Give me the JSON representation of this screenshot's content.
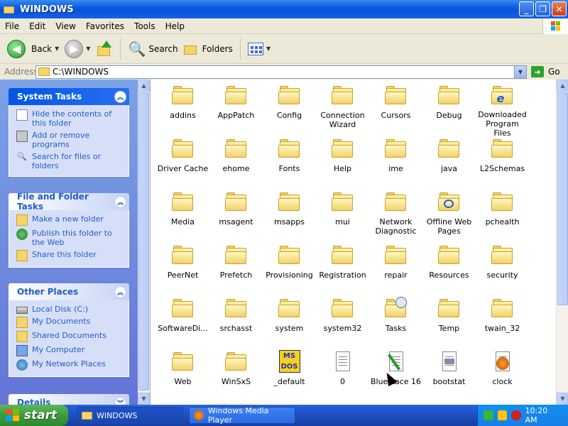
{
  "window": {
    "title": "WINDOWS"
  },
  "menu": [
    "File",
    "Edit",
    "View",
    "Favorites",
    "Tools",
    "Help"
  ],
  "toolbar": {
    "back_label": "Back",
    "search_label": "Search",
    "folders_label": "Folders"
  },
  "address": {
    "label": "Address",
    "value": "C:\\WINDOWS",
    "go_label": "Go"
  },
  "sidebar": {
    "system_tasks": {
      "title": "System Tasks",
      "items": [
        "Hide the contents of this folder",
        "Add or remove programs",
        "Search for files or folders"
      ]
    },
    "file_folder_tasks": {
      "title": "File and Folder Tasks",
      "items": [
        "Make a new folder",
        "Publish this folder to the Web",
        "Share this folder"
      ]
    },
    "other_places": {
      "title": "Other Places",
      "items": [
        "Local Disk (C:)",
        "My Documents",
        "Shared Documents",
        "My Computer",
        "My Network Places"
      ]
    },
    "details": {
      "title": "Details"
    }
  },
  "items": [
    {
      "label": "addins",
      "kind": "folder"
    },
    {
      "label": "AppPatch",
      "kind": "folder"
    },
    {
      "label": "Config",
      "kind": "folder"
    },
    {
      "label": "Connection Wizard",
      "kind": "folder"
    },
    {
      "label": "Cursors",
      "kind": "folder"
    },
    {
      "label": "Debug",
      "kind": "folder"
    },
    {
      "label": "Downloaded Program Files",
      "kind": "ie-folder"
    },
    {
      "label": "Driver Cache",
      "kind": "folder"
    },
    {
      "label": "ehome",
      "kind": "folder"
    },
    {
      "label": "Fonts",
      "kind": "folder"
    },
    {
      "label": "Help",
      "kind": "folder"
    },
    {
      "label": "ime",
      "kind": "folder"
    },
    {
      "label": "java",
      "kind": "folder"
    },
    {
      "label": "L2Schemas",
      "kind": "folder"
    },
    {
      "label": "Media",
      "kind": "folder"
    },
    {
      "label": "msagent",
      "kind": "folder"
    },
    {
      "label": "msapps",
      "kind": "folder"
    },
    {
      "label": "mui",
      "kind": "folder"
    },
    {
      "label": "Network Diagnostic",
      "kind": "folder"
    },
    {
      "label": "Offline Web Pages",
      "kind": "offline-folder"
    },
    {
      "label": "pchealth",
      "kind": "folder"
    },
    {
      "label": "PeerNet",
      "kind": "folder"
    },
    {
      "label": "Prefetch",
      "kind": "folder"
    },
    {
      "label": "Provisioning",
      "kind": "folder"
    },
    {
      "label": "Registration",
      "kind": "folder"
    },
    {
      "label": "repair",
      "kind": "folder"
    },
    {
      "label": "Resources",
      "kind": "folder"
    },
    {
      "label": "security",
      "kind": "folder"
    },
    {
      "label": "SoftwareDi...",
      "kind": "folder"
    },
    {
      "label": "srchasst",
      "kind": "folder"
    },
    {
      "label": "system",
      "kind": "folder"
    },
    {
      "label": "system32",
      "kind": "folder"
    },
    {
      "label": "Tasks",
      "kind": "tasks-folder"
    },
    {
      "label": "Temp",
      "kind": "folder"
    },
    {
      "label": "twain_32",
      "kind": "folder"
    },
    {
      "label": "Web",
      "kind": "folder"
    },
    {
      "label": "WinSxS",
      "kind": "folder"
    },
    {
      "label": "_default",
      "kind": "msdos"
    },
    {
      "label": "0",
      "kind": "text-file"
    },
    {
      "label": "Blue Lace 16",
      "kind": "bitmap"
    },
    {
      "label": "bootstat",
      "kind": "dat-file"
    },
    {
      "label": "clock",
      "kind": "media-file"
    }
  ],
  "taskbar": {
    "start_label": "start",
    "buttons": [
      "WINDOWS",
      "Windows Media Player"
    ],
    "clock": "10:20 AM"
  },
  "colors": {
    "titlebar": "#0a52d6",
    "sidebar": "#6375d6",
    "link": "#215dc6",
    "taskbar": "#245edb",
    "start": "#3c9a3c"
  }
}
